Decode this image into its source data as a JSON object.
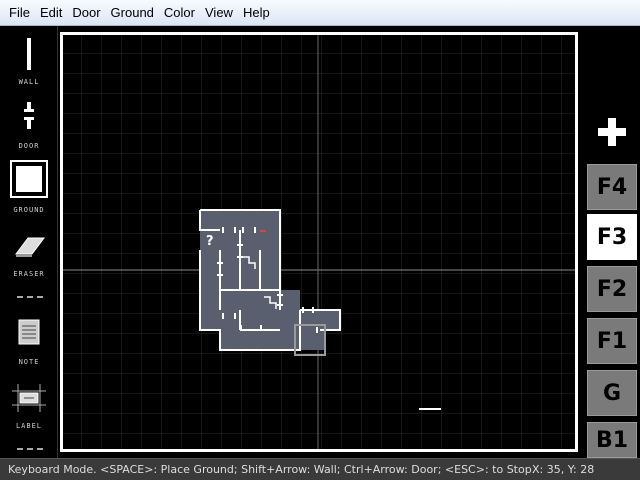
{
  "menu": {
    "items": [
      "File",
      "Edit",
      "Door",
      "Ground",
      "Color",
      "View",
      "Help"
    ]
  },
  "tools": [
    {
      "name": "wall",
      "label": "WALL",
      "icon": "wall-icon"
    },
    {
      "name": "door",
      "label": "DOOR",
      "icon": "door-icon"
    },
    {
      "name": "ground",
      "label": "GROUND",
      "icon": "ground-icon",
      "selected": true
    },
    {
      "name": "eraser",
      "label": "ERASER",
      "icon": "eraser-icon"
    },
    {
      "name": "note",
      "label": "NOTE",
      "icon": "note-icon"
    },
    {
      "name": "label",
      "label": "LABEL",
      "icon": "label-icon"
    }
  ],
  "floors": {
    "add": "+",
    "items": [
      "F4",
      "F3",
      "F2",
      "F1",
      "G",
      "B1"
    ],
    "active": "F3"
  },
  "map": {
    "note_marker": "?"
  },
  "status": {
    "message": "Keyboard Mode. <SPACE>: Place Ground; Shift+Arrow: Wall; Ctrl+Arrow: Door; <ESC>: to Stop.",
    "coords": "X: 35, Y: 28"
  },
  "colors": {
    "ground_fill": "#5a5f70",
    "wall": "#ffffff",
    "grid": "#2a2a2a",
    "active_floor": "#ffffff",
    "floor_button": "#7a7a7a"
  }
}
